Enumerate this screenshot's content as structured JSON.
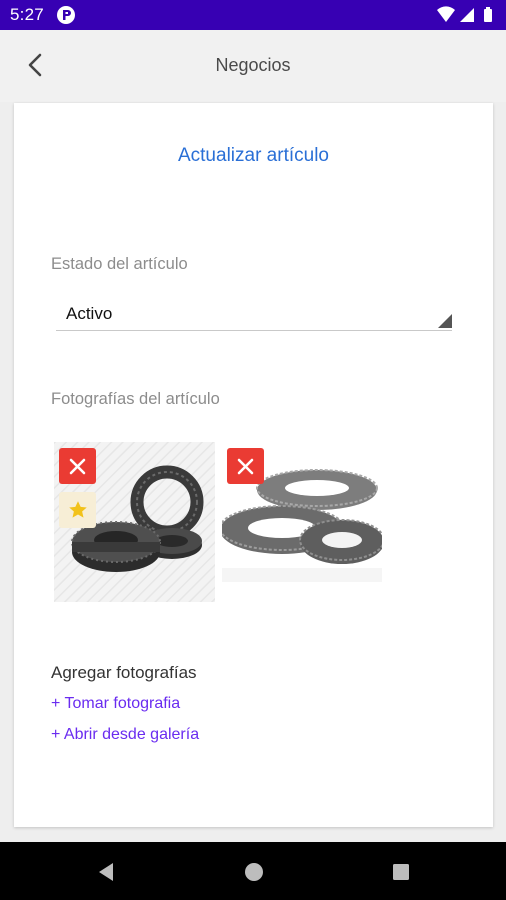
{
  "status_bar": {
    "time": "5:27",
    "app_icon": "app-notification-icon",
    "icons": [
      "wifi-icon",
      "signal-icon",
      "battery-icon"
    ]
  },
  "app_bar": {
    "title": "Negocios",
    "back_icon": "back-arrow-icon"
  },
  "form": {
    "title": "Actualizar artículo",
    "status_label": "Estado del artículo",
    "status_value": "Activo",
    "photos_label": "Fotografías del artículo",
    "photos": [
      {
        "name": "wire-coils-photo",
        "is_main": true,
        "remove_icon": "close-icon",
        "main_icon": "star-icon"
      },
      {
        "name": "wire-rolls-photo",
        "is_main": false,
        "remove_icon": "close-icon"
      }
    ],
    "add_photos_title": "Agregar fotografías",
    "take_photo_link": "+ Tomar fotografia",
    "gallery_link": "+ Abrir desde galería"
  },
  "colors": {
    "status_bar": "#3700b3",
    "title_blue": "#2a6fd6",
    "link_purple": "#6a2cf0",
    "remove_red": "#ea3b33",
    "star_yellow": "#f2c21b"
  },
  "nav_bar": {
    "buttons": [
      "back-triangle-icon",
      "home-circle-icon",
      "recents-square-icon"
    ]
  }
}
